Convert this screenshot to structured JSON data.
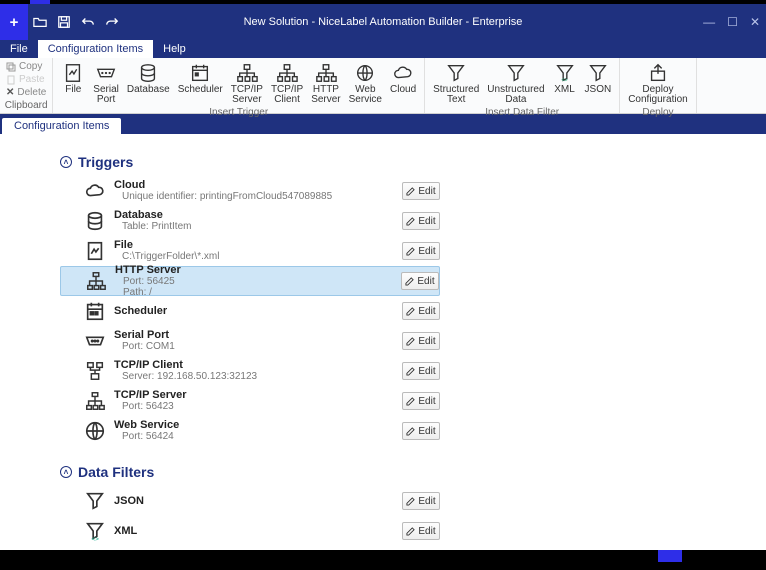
{
  "window": {
    "title": "New Solution - NiceLabel Automation Builder - Enterprise"
  },
  "menu": {
    "file": "File",
    "config": "Configuration Items",
    "help": "Help"
  },
  "ribbon": {
    "clipboard": {
      "copy": "Copy",
      "paste": "Paste",
      "delete": "Delete",
      "group": "Clipboard"
    },
    "insertTrigger": {
      "group": "Insert Trigger",
      "file": "File",
      "serial": "Serial\nPort",
      "database": "Database",
      "scheduler": "Scheduler",
      "tcpserver": "TCP/IP\nServer",
      "tcpclient": "TCP/IP\nClient",
      "httpserver": "HTTP\nServer",
      "webservice": "Web\nService",
      "cloud": "Cloud"
    },
    "insertFilter": {
      "group": "Insert Data Filter",
      "structured": "Structured\nText",
      "unstructured": "Unstructured\nData",
      "xml": "XML",
      "json": "JSON"
    },
    "deploy": {
      "group": "Deploy",
      "deploy": "Deploy\nConfiguration"
    }
  },
  "breadcrumb": "Configuration Items",
  "sections": {
    "triggers": "Triggers",
    "filters": "Data Filters"
  },
  "triggers": [
    {
      "title": "Cloud",
      "sub": "Unique identifier: printingFromCloud547089885",
      "icon": "cloud"
    },
    {
      "title": "Database",
      "sub": "Table: PrintItem",
      "icon": "database"
    },
    {
      "title": "File",
      "sub": "C:\\TriggerFolder\\*.xml",
      "icon": "file"
    },
    {
      "title": "HTTP Server",
      "sub": "Port: 56425",
      "sub2": "Path: /",
      "icon": "http",
      "selected": true
    },
    {
      "title": "Scheduler",
      "sub": "",
      "icon": "scheduler"
    },
    {
      "title": "Serial Port",
      "sub": "Port: COM1",
      "icon": "serial"
    },
    {
      "title": "TCP/IP Client",
      "sub": "Server: 192.168.50.123:32123",
      "icon": "tcpclient"
    },
    {
      "title": "TCP/IP Server",
      "sub": "Port: 56423",
      "icon": "tcpserver"
    },
    {
      "title": "Web Service",
      "sub": "Port: 56424",
      "icon": "webservice"
    }
  ],
  "filters": [
    {
      "title": "JSON",
      "icon": "json"
    },
    {
      "title": "XML",
      "icon": "xml"
    }
  ],
  "editLabel": "Edit"
}
